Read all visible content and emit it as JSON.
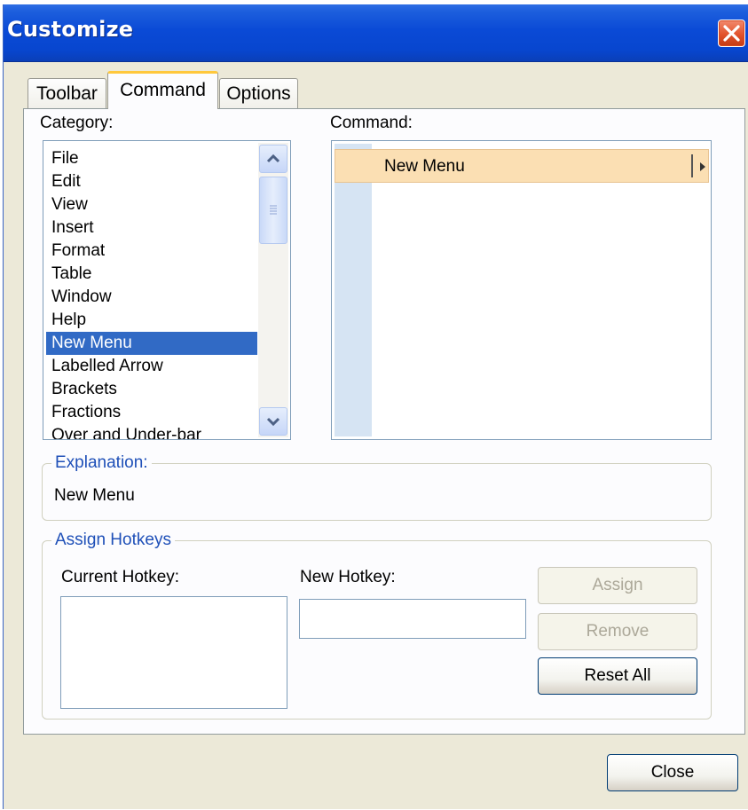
{
  "window": {
    "title": "Customize"
  },
  "tabs": [
    {
      "label": "Toolbar"
    },
    {
      "label": "Command"
    },
    {
      "label": "Options"
    }
  ],
  "active_tab": "Command",
  "category": {
    "label": "Category:",
    "items": [
      "File",
      "Edit",
      "View",
      "Insert",
      "Format",
      "Table",
      "Window",
      "Help",
      "New Menu",
      "Labelled Arrow",
      "Brackets",
      "Fractions",
      "Over and Under-bar"
    ],
    "selected": "New Menu"
  },
  "command": {
    "label": "Command:",
    "items": [
      {
        "label": "New Menu",
        "has_submenu": true
      }
    ]
  },
  "explanation": {
    "legend": "Explanation:",
    "text": "New Menu"
  },
  "hotkeys": {
    "legend": "Assign Hotkeys",
    "current_label": "Current Hotkey:",
    "new_label": "New Hotkey:",
    "new_value": "",
    "assign_label": "Assign",
    "remove_label": "Remove",
    "reset_label": "Reset All"
  },
  "footer": {
    "close_label": "Close"
  },
  "colors": {
    "title_bar": "#0a4ad6",
    "selection": "#316ac5",
    "command_highlight": "#fbdfb3",
    "active_tab_accent": "#ffc83c",
    "group_legend": "#1f50b8"
  }
}
